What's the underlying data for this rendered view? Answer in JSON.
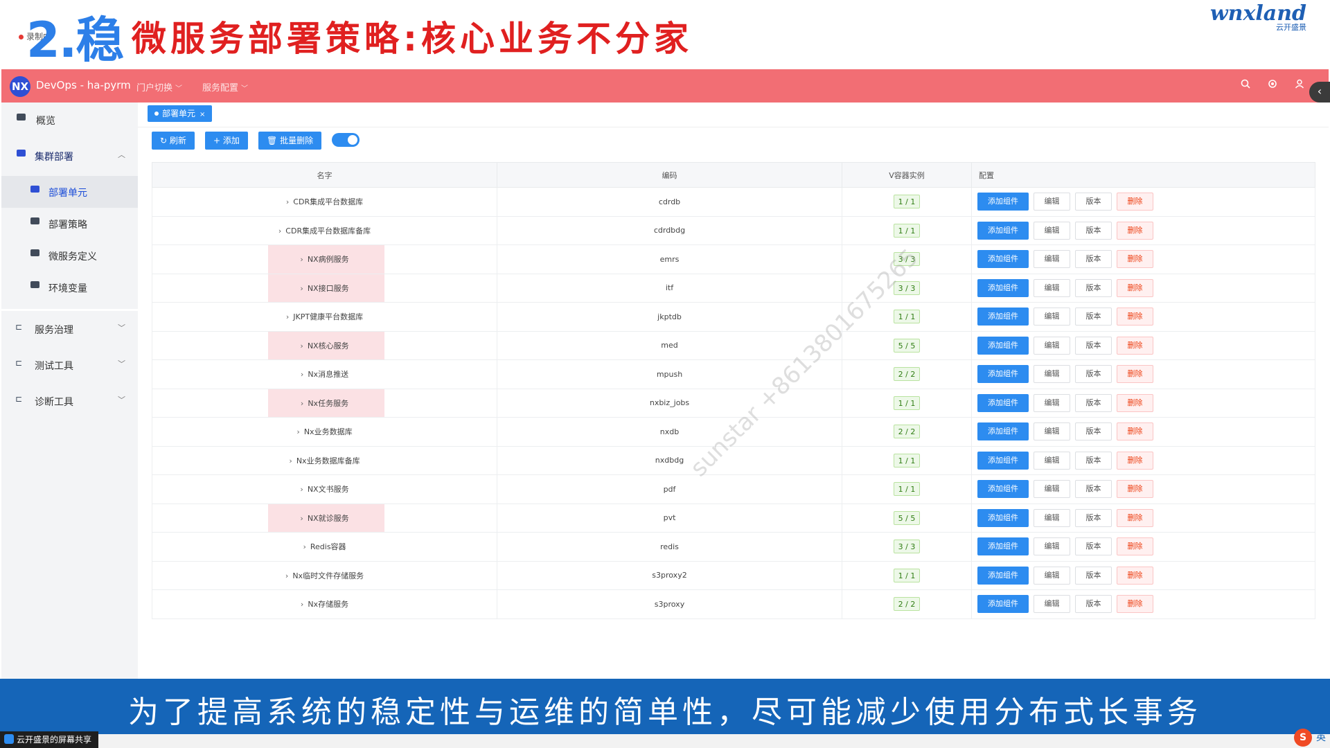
{
  "slide": {
    "number": "2.稳",
    "title": "微服务部署策略:核心业务不分家",
    "recording_label": "录制中",
    "brand_name": "wnxland",
    "brand_sub": "云开盛景",
    "subtitle": "为了提高系统的稳定性与运维的简单性，尽可能减少使用分布式长事务"
  },
  "app": {
    "logo": "NX",
    "title": "DevOps - ha-pyrm",
    "menus": [
      "门户切换",
      "服务配置"
    ],
    "icons": [
      "search-icon",
      "settings-icon",
      "user-icon"
    ]
  },
  "sidebar": {
    "items": [
      {
        "label": "概览"
      },
      {
        "label": "集群部署"
      },
      {
        "label": "部署单元"
      },
      {
        "label": "部署策略"
      },
      {
        "label": "微服务定义"
      },
      {
        "label": "环境变量"
      },
      {
        "label": "服务治理"
      },
      {
        "label": "测试工具"
      },
      {
        "label": "诊断工具"
      }
    ]
  },
  "tab": {
    "label": "部署单元",
    "close": "×"
  },
  "toolbar": {
    "refresh": "刷新",
    "add": "添加",
    "batch_delete": "批量删除"
  },
  "table": {
    "headers": {
      "name": "名字",
      "code": "编码",
      "instances": "V容器实例",
      "config": "配置"
    },
    "actions": {
      "add_component": "添加组件",
      "edit": "编辑",
      "version": "版本",
      "delete": "删除"
    },
    "rows": [
      {
        "name": "CDR集成平台数据库",
        "code": "cdrdb",
        "instances": "1 / 1",
        "highlight": false
      },
      {
        "name": "CDR集成平台数据库备库",
        "code": "cdrdbdg",
        "instances": "1 / 1",
        "highlight": false
      },
      {
        "name": "NX病例服务",
        "code": "emrs",
        "instances": "3 / 3",
        "highlight": true
      },
      {
        "name": "NX接口服务",
        "code": "itf",
        "instances": "3 / 3",
        "highlight": true
      },
      {
        "name": "JKPT健康平台数据库",
        "code": "jkptdb",
        "instances": "1 / 1",
        "highlight": false
      },
      {
        "name": "NX核心服务",
        "code": "med",
        "instances": "5 / 5",
        "highlight": true
      },
      {
        "name": "Nx消息推送",
        "code": "mpush",
        "instances": "2 / 2",
        "highlight": false
      },
      {
        "name": "Nx任务服务",
        "code": "nxbiz_jobs",
        "instances": "1 / 1",
        "highlight": true
      },
      {
        "name": "Nx业务数据库",
        "code": "nxdb",
        "instances": "2 / 2",
        "highlight": false
      },
      {
        "name": "Nx业务数据库备库",
        "code": "nxdbdg",
        "instances": "1 / 1",
        "highlight": false
      },
      {
        "name": "NX文书服务",
        "code": "pdf",
        "instances": "1 / 1",
        "highlight": false
      },
      {
        "name": "NX就诊服务",
        "code": "pvt",
        "instances": "5 / 5",
        "highlight": true
      },
      {
        "name": "Redis容器",
        "code": "redis",
        "instances": "3 / 3",
        "highlight": false
      },
      {
        "name": "Nx临时文件存储服务",
        "code": "s3proxy2",
        "instances": "1 / 1",
        "highlight": false
      },
      {
        "name": "Nx存储服务",
        "code": "s3proxy",
        "instances": "2 / 2",
        "highlight": false
      }
    ]
  },
  "watermark": "sunstar +8613801675265",
  "screen_share": "云开盛景的屏幕共享",
  "ime": {
    "logo": "S",
    "lang": "英"
  },
  "colors": {
    "topbar": "#f26e74",
    "primary": "#2d8cf0",
    "title_red": "#e02020",
    "subtitle_bg": "#1565b8"
  }
}
